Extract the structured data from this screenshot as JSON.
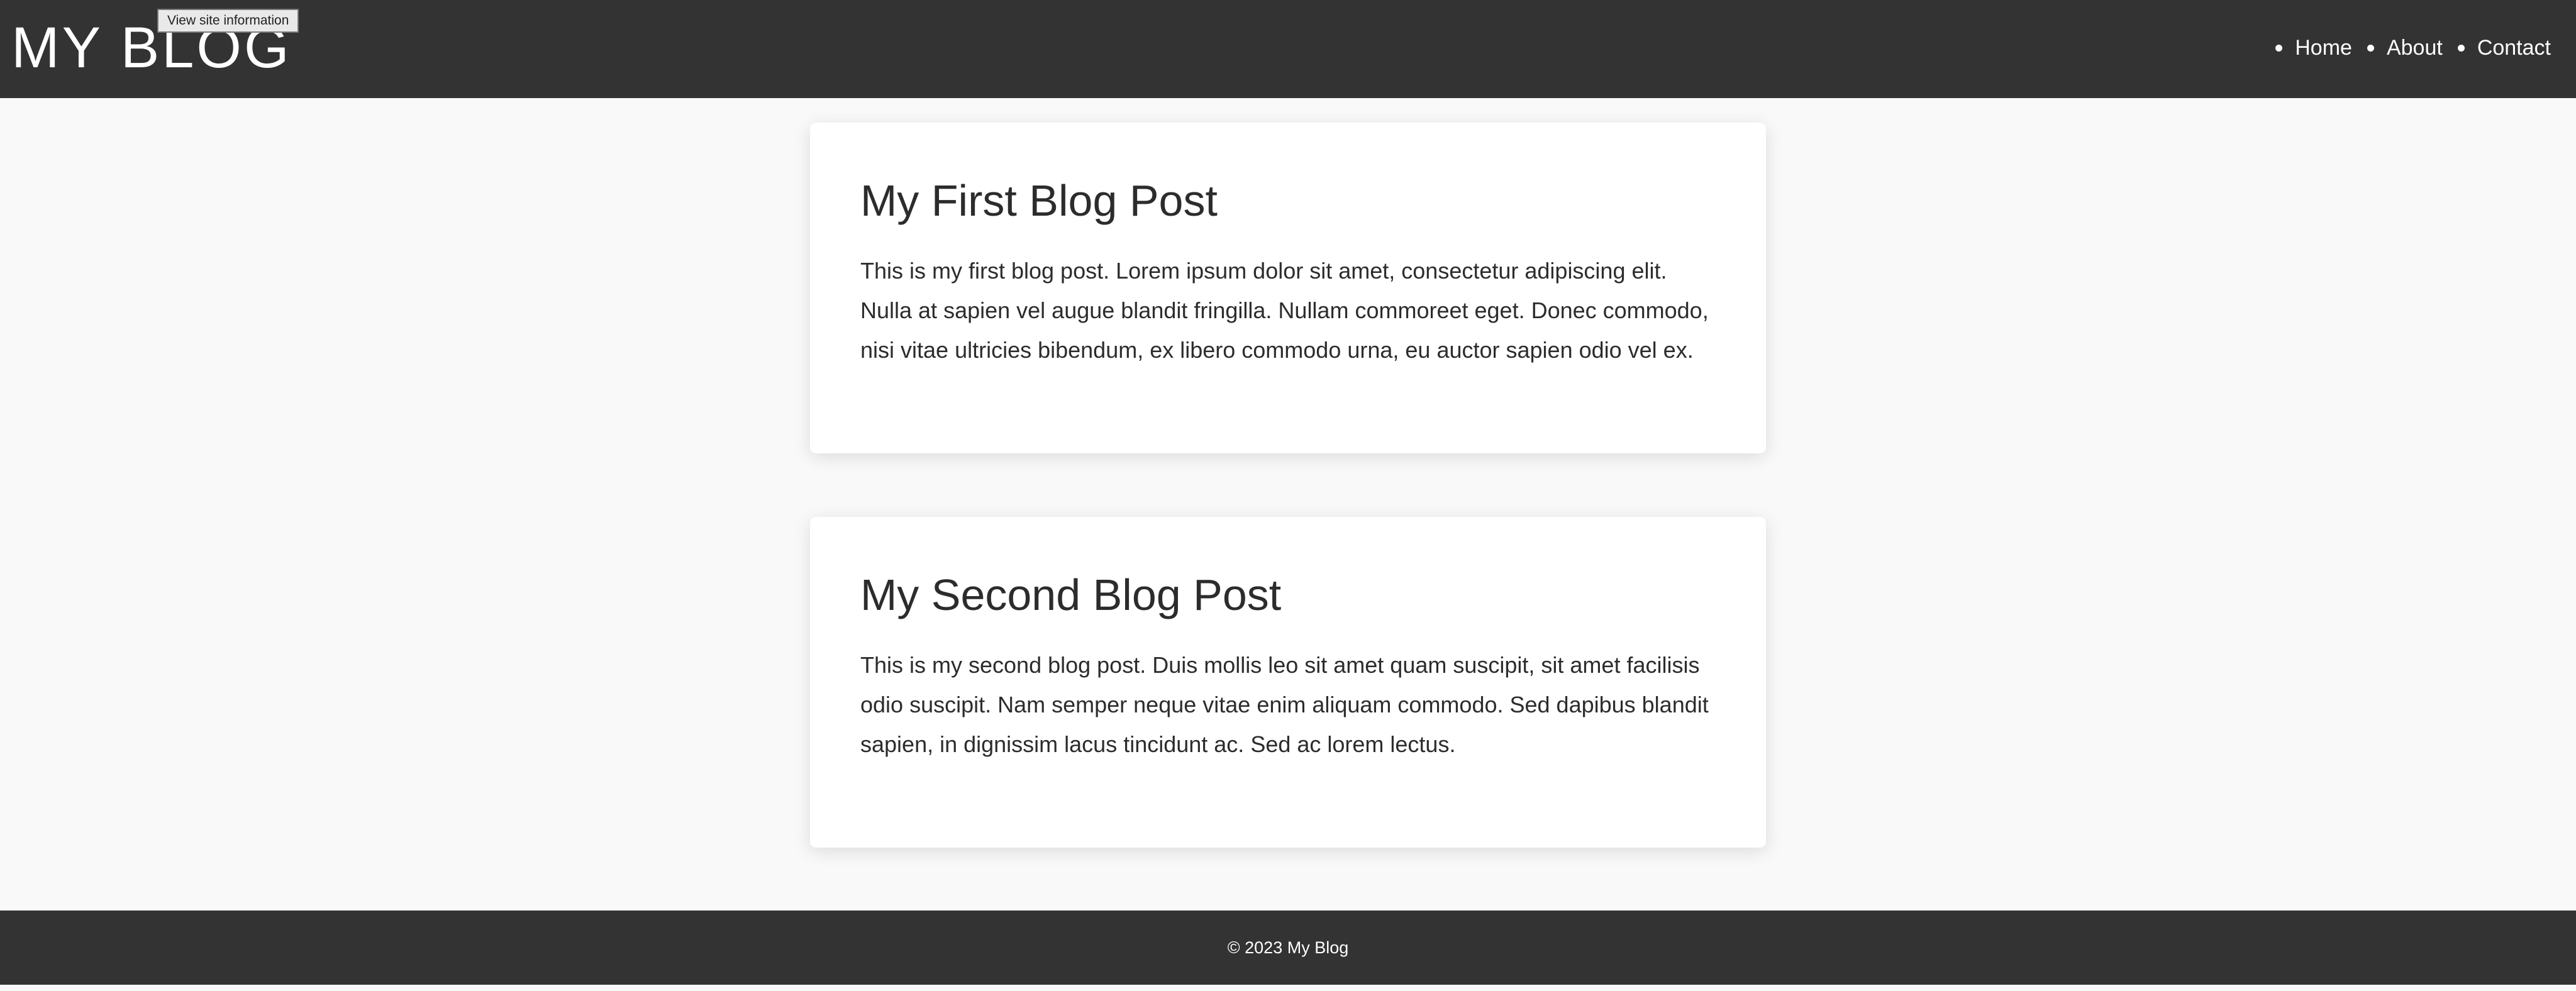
{
  "header": {
    "site_title": "MY BLOG",
    "site_info_button": "View site information",
    "nav": [
      "Home",
      "About",
      "Contact"
    ]
  },
  "posts": [
    {
      "title": "My First Blog Post",
      "body": "This is my first blog post. Lorem ipsum dolor sit amet, consectetur adipiscing elit. Nulla at sapien vel augue blandit fringilla. Nullam commoreet eget. Donec commodo, nisi vitae ultricies bibendum, ex libero commodo urna, eu auctor sapien odio vel ex."
    },
    {
      "title": "My Second Blog Post",
      "body": "This is my second blog post. Duis mollis leo sit amet quam suscipit, sit amet facilisis odio suscipit. Nam semper neque vitae enim aliquam commodo. Sed dapibus blandit sapien, in dignissim lacus tincidunt ac. Sed ac lorem lectus."
    }
  ],
  "footer": {
    "text": "© 2023 My Blog"
  },
  "colors": {
    "header_bg": "#333333",
    "page_bg": "#f9f9f9",
    "card_bg": "#ffffff",
    "text": "#2c2c2c"
  }
}
